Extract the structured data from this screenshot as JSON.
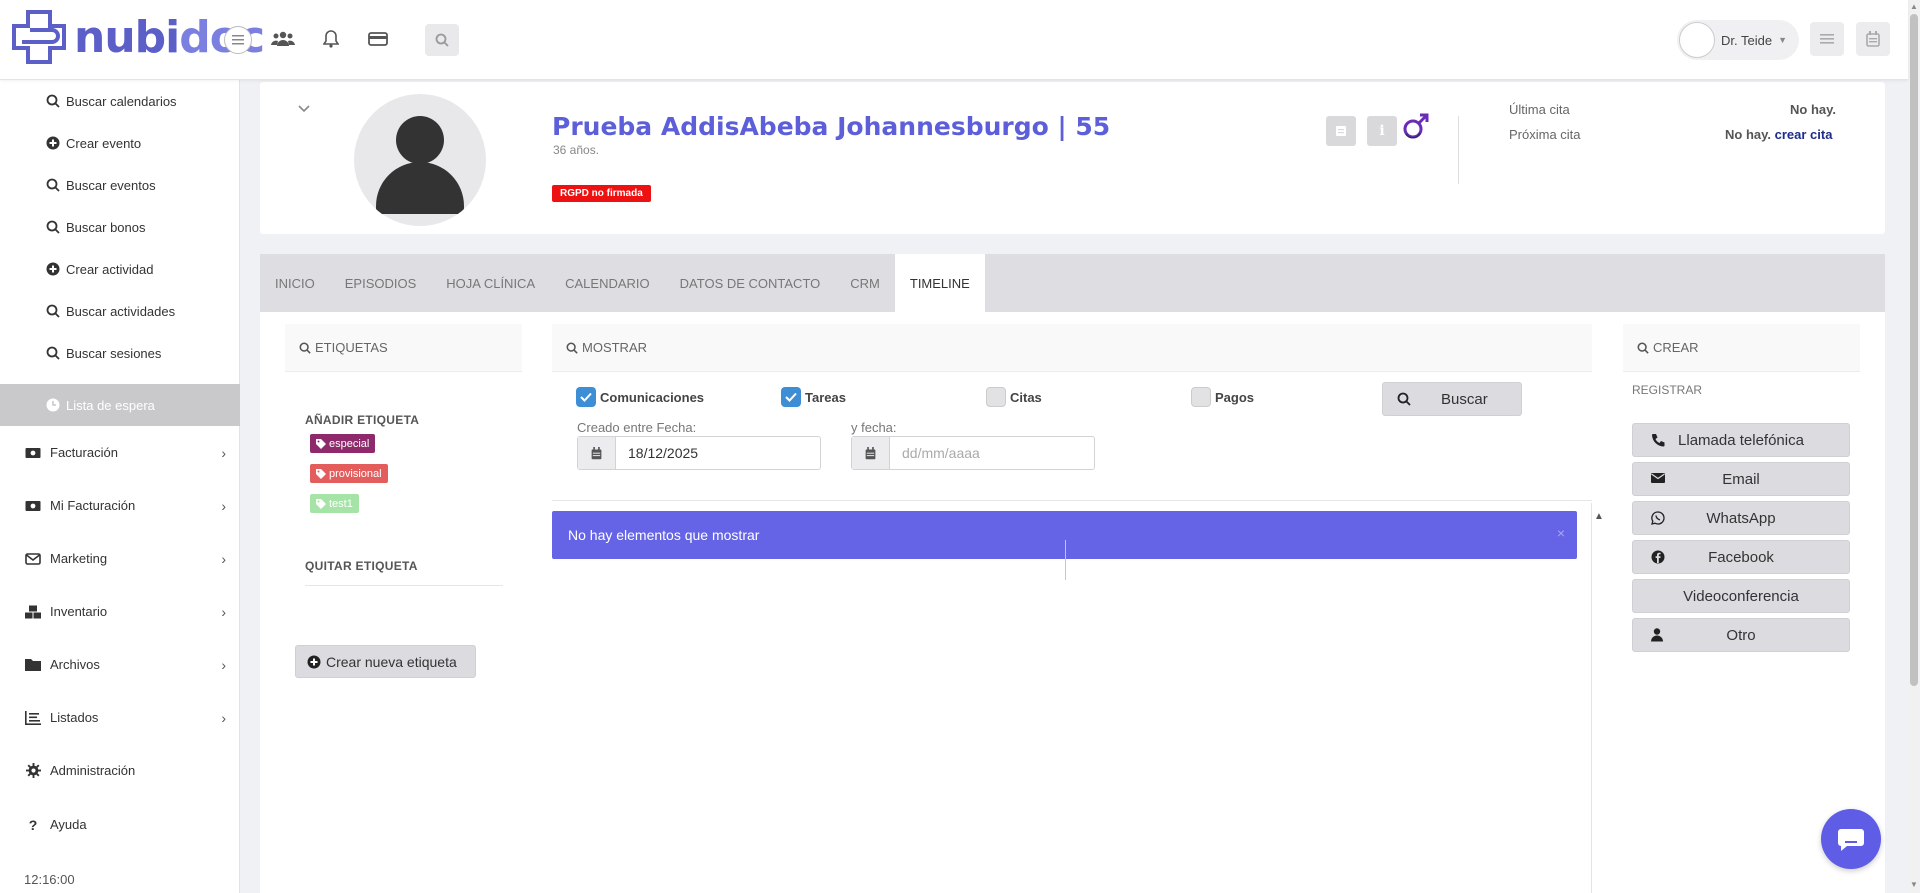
{
  "app": {
    "logo_a": "nubi",
    "logo_b": "doc"
  },
  "topbar": {
    "user_name": "Dr. Teide",
    "search_icon": "search-icon",
    "icons": [
      "users-icon",
      "bell-icon",
      "card-icon"
    ]
  },
  "sidebar": {
    "sub_items": [
      {
        "label": "Buscar calendarios",
        "icon": "search-icon"
      },
      {
        "label": "Crear evento",
        "icon": "plus-circle-icon"
      },
      {
        "label": "Buscar eventos",
        "icon": "search-icon"
      },
      {
        "label": "Buscar bonos",
        "icon": "search-icon"
      },
      {
        "label": "Crear actividad",
        "icon": "plus-circle-icon"
      },
      {
        "label": "Buscar actividades",
        "icon": "search-icon"
      },
      {
        "label": "Buscar sesiones",
        "icon": "search-icon"
      },
      {
        "label": "Lista de espera",
        "icon": "clock-icon"
      }
    ],
    "main_items": [
      {
        "label": "Facturación",
        "icon": "money-icon"
      },
      {
        "label": "Mi Facturación",
        "icon": "money-icon"
      },
      {
        "label": "Marketing",
        "icon": "envelope-icon"
      },
      {
        "label": "Inventario",
        "icon": "cubes-icon"
      },
      {
        "label": "Archivos",
        "icon": "folder-icon"
      },
      {
        "label": "Listados",
        "icon": "list-icon"
      },
      {
        "label": "Administración",
        "icon": "gear-icon"
      },
      {
        "label": "Ayuda",
        "icon": "question-icon"
      }
    ],
    "clock": "12:16:00"
  },
  "patient": {
    "name": "Prueba AddisAbeba Johannesburgo | 55",
    "age": "36 años.",
    "rgpd_badge": "RGPD no firmada",
    "ultima_cita_label": "Última cita",
    "ultima_cita_value": "No hay.",
    "proxima_cita_label": "Próxima cita",
    "proxima_cita_value": "No hay.",
    "crear_cita_link": "crear cita",
    "gender_icon": "male-icon"
  },
  "tabs": [
    {
      "label": "INICIO"
    },
    {
      "label": "EPISODIOS"
    },
    {
      "label": "HOJA CLÍNICA"
    },
    {
      "label": "CALENDARIO"
    },
    {
      "label": "DATOS DE CONTACTO"
    },
    {
      "label": "CRM"
    },
    {
      "label": "TIMELINE",
      "active": true
    }
  ],
  "etiquetas": {
    "header": "ETIQUETAS",
    "add_title": "AÑADIR ETIQUETA",
    "tags": [
      {
        "label": "especial",
        "color": "#8e2a6b"
      },
      {
        "label": "provisional",
        "color": "#e35d5d"
      },
      {
        "label": "test1",
        "color": "#a6e3a6"
      }
    ],
    "remove_title": "QUITAR ETIQUETA",
    "create_button": "Crear nueva etiqueta"
  },
  "mostrar": {
    "header": "MOSTRAR",
    "filters": [
      {
        "label": "Comunicaciones",
        "checked": true
      },
      {
        "label": "Tareas",
        "checked": true
      },
      {
        "label": "Citas",
        "checked": false
      },
      {
        "label": "Pagos",
        "checked": false
      }
    ],
    "search_button": "Buscar",
    "from_label": "Creado entre Fecha:",
    "from_value": "18/12/2025",
    "to_label": "y fecha:",
    "to_placeholder": "dd/mm/aaaa",
    "empty_message": "No hay elementos que mostrar",
    "close_glyph": "×"
  },
  "crear": {
    "header": "CREAR",
    "registrar": "REGISTRAR",
    "buttons": [
      {
        "label": "Llamada telefónica",
        "icon": "phone-icon"
      },
      {
        "label": "Email",
        "icon": "envelope-icon"
      },
      {
        "label": "WhatsApp",
        "icon": "whatsapp-icon"
      },
      {
        "label": "Facebook",
        "icon": "facebook-icon"
      },
      {
        "label": "Videoconferencia",
        "icon": ""
      },
      {
        "label": "Otro",
        "icon": "user-icon"
      }
    ]
  },
  "colors": {
    "brand": "#5c5fd9",
    "alert": "#6563e6",
    "rgpd": "#ee1111",
    "checkbox": "#3e8ed6",
    "link": "#1e2c8a"
  }
}
